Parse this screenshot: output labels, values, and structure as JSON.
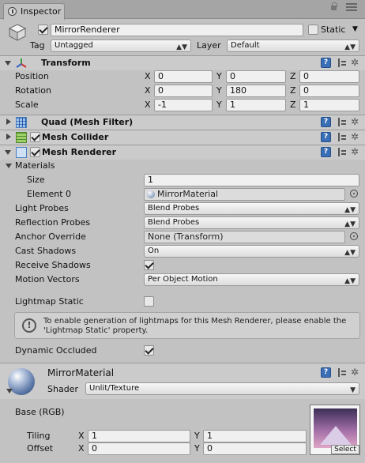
{
  "tab": {
    "label": "Inspector"
  },
  "object": {
    "name": "MirrorRenderer",
    "active": true,
    "static_label": "Static",
    "static_checked": false,
    "tag_label": "Tag",
    "tag_value": "Untagged",
    "layer_label": "Layer",
    "layer_value": "Default"
  },
  "transform": {
    "title": "Transform",
    "position_label": "Position",
    "rotation_label": "Rotation",
    "scale_label": "Scale",
    "axis_x": "X",
    "axis_y": "Y",
    "axis_z": "Z",
    "position": {
      "x": "0",
      "y": "0",
      "z": "0"
    },
    "rotation": {
      "x": "0",
      "y": "180",
      "z": "0"
    },
    "scale": {
      "x": "-1",
      "y": "1",
      "z": "1"
    }
  },
  "components": {
    "mesh_filter": "Quad (Mesh Filter)",
    "mesh_collider": "Mesh Collider",
    "mesh_renderer": "Mesh Renderer"
  },
  "mesh_renderer": {
    "materials_label": "Materials",
    "size_label": "Size",
    "size_value": "1",
    "element0_label": "Element 0",
    "element0_value": "MirrorMaterial",
    "light_probes_label": "Light Probes",
    "light_probes_value": "Blend Probes",
    "reflection_probes_label": "Reflection Probes",
    "reflection_probes_value": "Blend Probes",
    "anchor_override_label": "Anchor Override",
    "anchor_override_value": "None (Transform)",
    "cast_shadows_label": "Cast Shadows",
    "cast_shadows_value": "On",
    "receive_shadows_label": "Receive Shadows",
    "receive_shadows_checked": true,
    "motion_vectors_label": "Motion Vectors",
    "motion_vectors_value": "Per Object Motion",
    "lightmap_static_label": "Lightmap Static",
    "lightmap_static_checked": false,
    "info_text": "To enable generation of lightmaps for this Mesh Renderer, please enable the 'Lightmap Static' property.",
    "dynamic_occluded_label": "Dynamic Occluded",
    "dynamic_occluded_checked": true
  },
  "material": {
    "name": "MirrorMaterial",
    "shader_label": "Shader",
    "shader_value": "Unlit/Texture",
    "base_label": "Base (RGB)",
    "tiling_label": "Tiling",
    "offset_label": "Offset",
    "axis_x": "X",
    "axis_y": "Y",
    "tiling": {
      "x": "1",
      "y": "1"
    },
    "offset": {
      "x": "0",
      "y": "0"
    },
    "select_label": "Select"
  },
  "colors": {
    "panel_bg": "#c2c2c2",
    "header_bg": "#cbcbcb",
    "help_icon": "#3b6fb5"
  }
}
